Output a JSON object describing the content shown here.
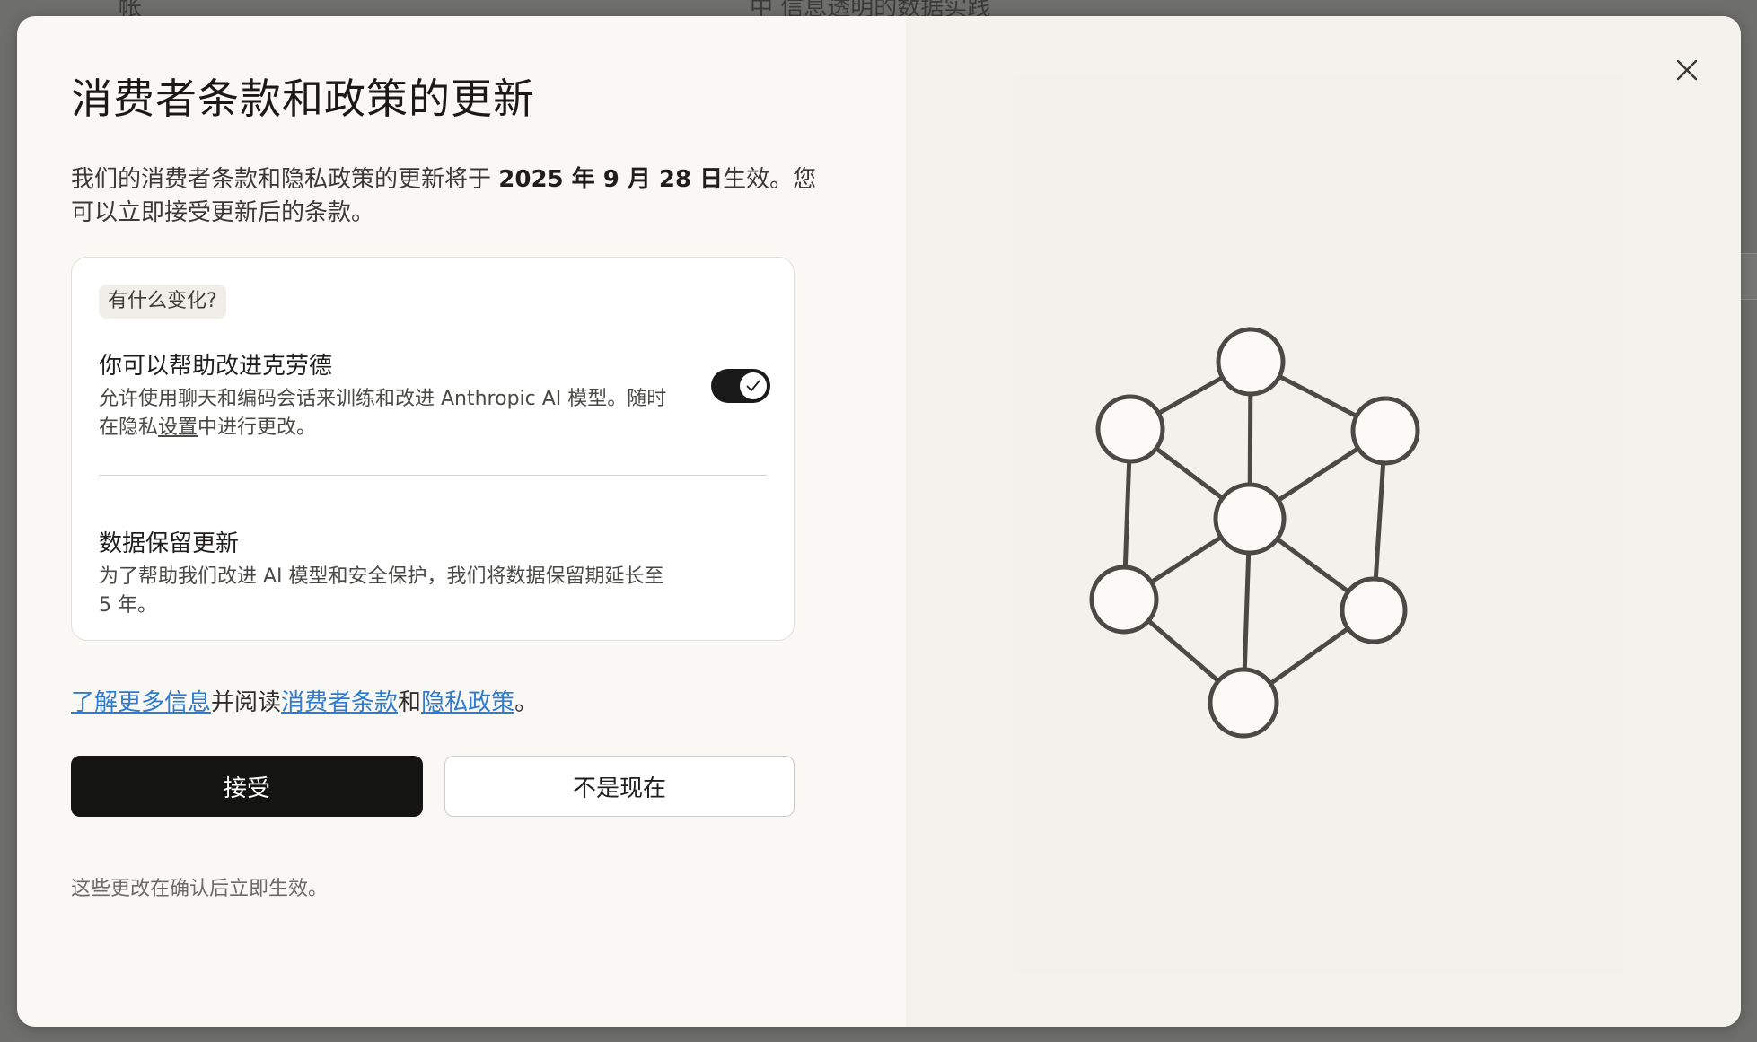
{
  "backdrop": {
    "left_text": "帐",
    "right_text": "中 信息透明的数据实践"
  },
  "dialog": {
    "title": "消费者条款和政策的更新",
    "intro_prefix": "我们的消费者条款和隐私政策的更新将于 ",
    "effective_date": "2025 年 9 月 28 日",
    "intro_suffix": "生效。您可以立即接受更新后的条款。",
    "close_icon": "close-icon"
  },
  "changes": {
    "badge": "有什么变化?",
    "improve": {
      "title": "你可以帮助改进克劳德",
      "desc_prefix": "允许使用聊天和编码会话来训练和改进 Anthropic AI 模型。随时在隐私",
      "desc_link": "设置",
      "desc_suffix": "中进行更改。",
      "toggle_on": true
    },
    "retention": {
      "title": "数据保留更新",
      "desc": "为了帮助我们改进 AI 模型和安全保护，我们将数据保留期延长至 5 年。"
    }
  },
  "links": {
    "learn_more": "了解更多信息",
    "text_read": "并阅读",
    "consumer_terms": "消费者条款",
    "text_and": "和",
    "privacy_policy": "隐私政策",
    "text_end": "。"
  },
  "buttons": {
    "accept": "接受",
    "not_now": "不是现在"
  },
  "footnote": "这些更改在确认后立即生效。",
  "illustration": {
    "icon": "network-graph-icon"
  },
  "colors": {
    "accent_link": "#2f7bd0",
    "primary_button": "#141413",
    "overlay": "#6e6e6c"
  }
}
